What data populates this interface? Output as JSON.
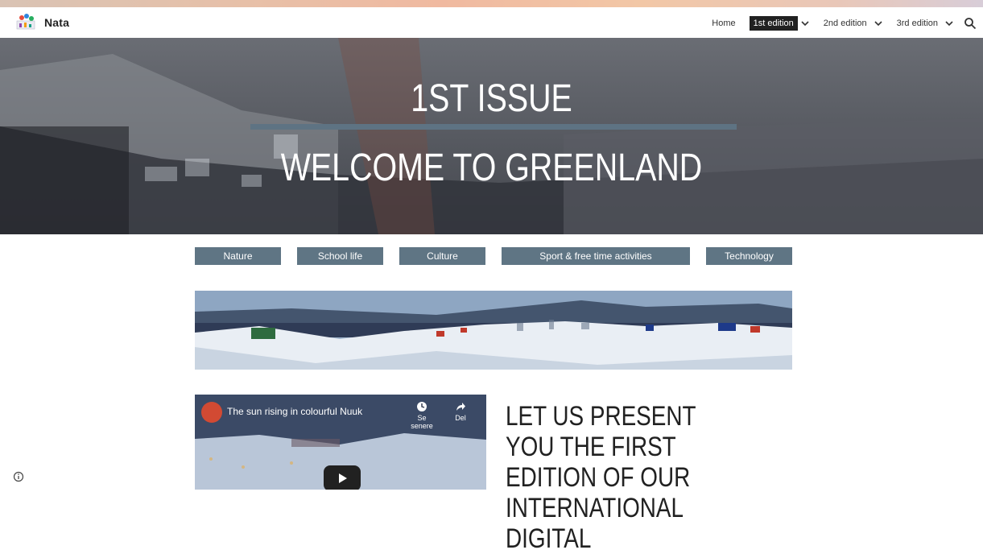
{
  "site": {
    "name": "Nata"
  },
  "nav": {
    "items": [
      {
        "label": "Home",
        "active": false,
        "dropdown": false
      },
      {
        "label": "1st edition",
        "active": true,
        "dropdown": true
      },
      {
        "label": "2nd edition",
        "active": false,
        "dropdown": true
      },
      {
        "label": "3rd edition",
        "active": false,
        "dropdown": true
      }
    ],
    "search_icon": "search-icon"
  },
  "hero": {
    "title": "1ST ISSUE",
    "subtitle": "WELCOME TO GREENLAND",
    "rule_color": "#5e7383"
  },
  "categories": [
    "Nature",
    "School life",
    "Culture",
    "Sport & free time activities",
    "Technology"
  ],
  "category_color": "#5f7584",
  "video": {
    "title": "The sun rising in colourful Nuuk",
    "actions": [
      "Se senere",
      "Del"
    ]
  },
  "headline": "LET US PRESENT YOU THE FIRST EDITION OF OUR INTERNATIONAL DIGITAL"
}
